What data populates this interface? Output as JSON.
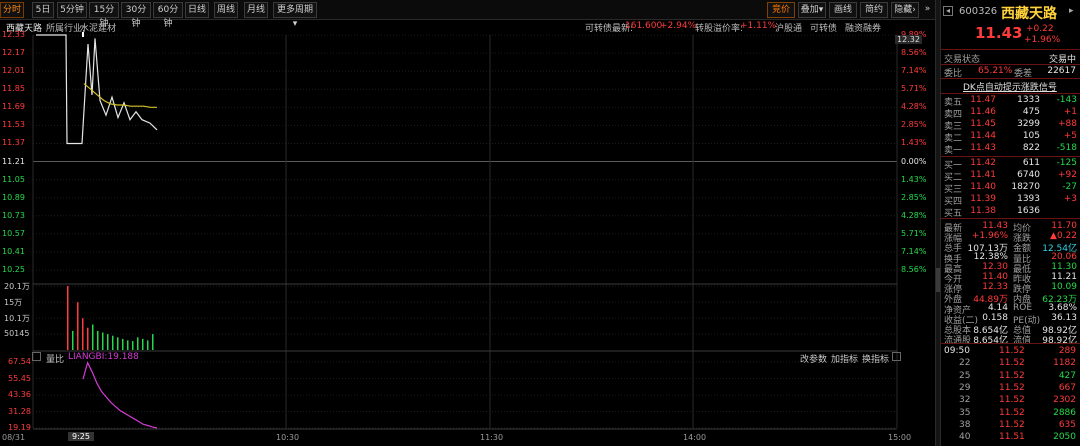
{
  "tabs": {
    "periods": [
      "分时",
      "5日",
      "5分钟",
      "15分钟",
      "30分钟",
      "60分钟",
      "日线",
      "周线",
      "月线",
      "更多周期"
    ],
    "right": [
      "竞价",
      "叠加",
      "画线",
      "简约",
      "隐藏"
    ]
  },
  "info": {
    "stock_name": "西藏天路",
    "industry_label": "所属行业:",
    "industry": "水泥建材",
    "convertible_price_label": "可转债最新:",
    "convertible_price": "161.600",
    "convertible_change": "+2.94%",
    "conversion_premium_label": "转股溢价率:",
    "conversion_premium": "+1.11%",
    "links": [
      "沪股通",
      "可转债",
      "融资融券"
    ]
  },
  "price_axis": {
    "left": [
      "12.33",
      "12.17",
      "12.01",
      "11.85",
      "11.69",
      "11.53",
      "11.37",
      "11.21",
      "11.05",
      "10.89",
      "10.73",
      "10.57",
      "10.41",
      "10.25"
    ],
    "right": [
      "9.89%",
      "8.56%",
      "7.14%",
      "5.71%",
      "4.28%",
      "2.85%",
      "1.43%",
      "0.00%",
      "1.43%",
      "2.85%",
      "4.28%",
      "5.71%",
      "7.14%",
      "8.56%"
    ],
    "cursor_price": "12.32"
  },
  "volume_axis": [
    "20.1万",
    "15万",
    "10.1万",
    "50145"
  ],
  "indicator": {
    "name": "量比",
    "label": "LIANGBI:19.188",
    "buttons": [
      "改参数",
      "加指标",
      "换指标"
    ],
    "axis": [
      "67.54",
      "55.45",
      "43.36",
      "31.28",
      "19.19"
    ]
  },
  "time_axis": {
    "date": "08/31",
    "cursor_time": "9:25",
    "ticks": [
      "10:30",
      "11:30",
      "14:00",
      "15:00"
    ]
  },
  "quote": {
    "code": "600326",
    "name": "西藏天路",
    "price": "11.43",
    "change": "+0.22",
    "change_pct": "+1.96%",
    "status_label": "交易状态",
    "status": "交易中",
    "weibi_label": "委比",
    "weibi": "65.21%",
    "weicha_label": "委差",
    "weicha": "22617",
    "signal_link": "DK点自动提示涨跌信号",
    "asks": [
      {
        "label": "卖五",
        "price": "11.47",
        "vol": "1333",
        "chg": "-143"
      },
      {
        "label": "卖四",
        "price": "11.46",
        "vol": "475",
        "chg": "+1"
      },
      {
        "label": "卖三",
        "price": "11.45",
        "vol": "3299",
        "chg": "+88"
      },
      {
        "label": "卖二",
        "price": "11.44",
        "vol": "105",
        "chg": "+5"
      },
      {
        "label": "卖一",
        "price": "11.43",
        "vol": "822",
        "chg": "-518"
      }
    ],
    "bids": [
      {
        "label": "买一",
        "price": "11.42",
        "vol": "611",
        "chg": "-125"
      },
      {
        "label": "买二",
        "price": "11.41",
        "vol": "6740",
        "chg": "+92"
      },
      {
        "label": "买三",
        "price": "11.40",
        "vol": "18270",
        "chg": "-27"
      },
      {
        "label": "买四",
        "price": "11.39",
        "vol": "1393",
        "chg": "+3"
      },
      {
        "label": "买五",
        "price": "11.38",
        "vol": "1636",
        "chg": ""
      }
    ],
    "stats": [
      {
        "l1": "最新",
        "v1": "11.43",
        "l2": "均价",
        "v2": "11.70"
      },
      {
        "l1": "涨幅",
        "v1": "+1.96%",
        "l2": "涨跌",
        "v2": "▲0.22"
      },
      {
        "l1": "总手",
        "v1": "107.13万",
        "l2": "金额",
        "v2": "12.54亿"
      },
      {
        "l1": "换手",
        "v1": "12.38%",
        "l2": "量比",
        "v2": "20.06"
      },
      {
        "l1": "最高",
        "v1": "12.30",
        "l2": "最低",
        "v2": "11.30"
      },
      {
        "l1": "今开",
        "v1": "11.40",
        "l2": "昨收",
        "v2": "11.21"
      },
      {
        "l1": "涨停",
        "v1": "12.33",
        "l2": "跌停",
        "v2": "10.09"
      },
      {
        "l1": "外盘",
        "v1": "44.89万",
        "l2": "内盘",
        "v2": "62.23万"
      },
      {
        "l1": "净资产",
        "v1": "4.14",
        "l2": "ROE",
        "v2": "3.68%"
      },
      {
        "l1": "收益(二)",
        "v1": "0.158",
        "l2": "PE(动)",
        "v2": "36.13"
      },
      {
        "l1": "总股本",
        "v1": "8.654亿",
        "l2": "总值",
        "v2": "98.92亿"
      },
      {
        "l1": "流通股",
        "v1": "8.654亿",
        "l2": "流值",
        "v2": "98.92亿"
      }
    ],
    "trades": [
      {
        "time": "09:50",
        "price": "11.52",
        "vol": "289"
      },
      {
        "time": "22",
        "price": "11.52",
        "vol": "1182"
      },
      {
        "time": "25",
        "price": "11.52",
        "vol": "427"
      },
      {
        "time": "29",
        "price": "11.52",
        "vol": "667"
      },
      {
        "time": "32",
        "price": "11.52",
        "vol": "2302"
      },
      {
        "time": "35",
        "price": "11.52",
        "vol": "2886"
      },
      {
        "time": "38",
        "price": "11.52",
        "vol": "635"
      },
      {
        "time": "40",
        "price": "11.51",
        "vol": "2050"
      }
    ]
  },
  "colors": {
    "up": "#ff3b3b",
    "down": "#25d94a",
    "price_line": "#e6e6e6",
    "avg_line": "#d6c22a",
    "indicator_line": "#d43bd4"
  },
  "chart_data": {
    "type": "line",
    "series": [
      {
        "values": [
          12.33,
          12.33,
          12.33,
          12.33,
          12.33,
          11.37,
          11.37,
          11.37,
          12.25,
          11.8,
          12.3,
          11.75,
          11.62,
          11.78,
          11.6,
          11.73,
          11.58,
          11.65,
          11.58,
          11.55,
          11.49
        ]
      },
      {
        "values": [
          11.9,
          11.85,
          11.8,
          11.75,
          11.72,
          11.71,
          11.71,
          11.7,
          11.7,
          11.7,
          11.69,
          11.69
        ]
      }
    ],
    "volumes": [
      201000,
      60000,
      150000,
      100000,
      70000,
      80000,
      60000,
      55000,
      50000,
      45000,
      40000,
      35000,
      30000,
      28000,
      40000,
      35000,
      30000,
      50000
    ]
  }
}
